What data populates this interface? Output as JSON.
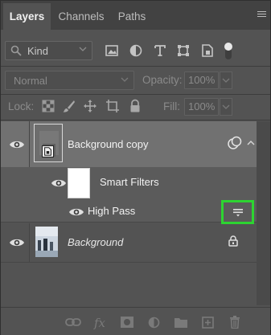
{
  "tabs": [
    {
      "label": "Layers",
      "active": true
    },
    {
      "label": "Channels",
      "active": false
    },
    {
      "label": "Paths",
      "active": false
    }
  ],
  "filter": {
    "kind_label": "Kind",
    "icons": [
      "image-filter-icon",
      "adjustment-filter-icon",
      "type-filter-icon",
      "shape-filter-icon",
      "smart-object-filter-icon",
      "filter-toggle-icon"
    ]
  },
  "blend": {
    "mode": "Normal",
    "opacity_label": "Opacity:",
    "opacity_value": "100%",
    "fill_label": "Fill:",
    "fill_value": "100%",
    "lock_label": "Lock:"
  },
  "layers": [
    {
      "name": "Background copy",
      "type": "smart-object",
      "visible": true,
      "selected": true
    },
    {
      "name": "Smart Filters",
      "type": "smart-filters",
      "visible": true
    },
    {
      "name": "High Pass",
      "type": "filter",
      "visible": true
    },
    {
      "name": "Background",
      "type": "image",
      "visible": true,
      "locked": true
    }
  ],
  "bottom_bar": [
    "link-layers-icon",
    "fx-icon",
    "add-mask-icon",
    "adjustment-layer-icon",
    "new-group-icon",
    "new-layer-icon",
    "delete-icon"
  ],
  "bottom_fx_label": "fx",
  "colors": {
    "panel": "#535353",
    "selected_row": "#717171",
    "highlight": "#2dd431"
  }
}
